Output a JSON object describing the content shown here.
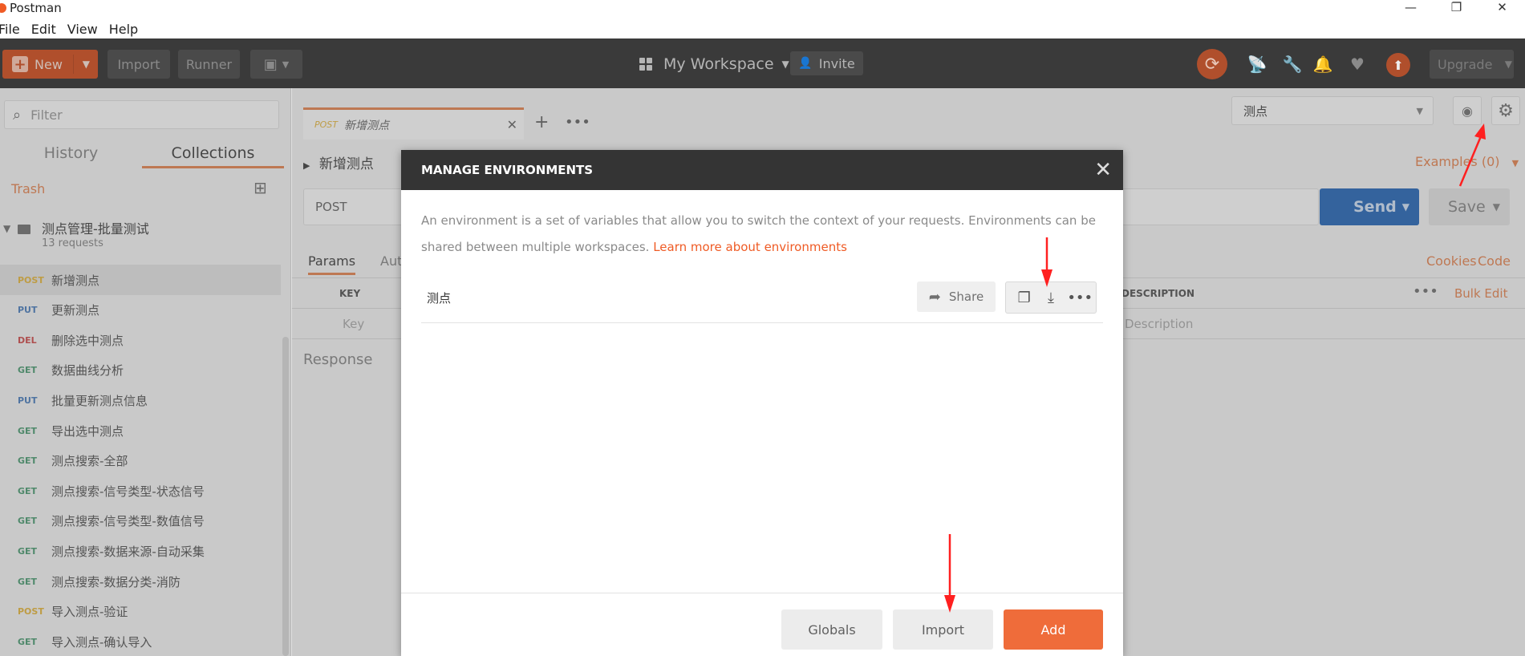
{
  "window": {
    "title": "Postman",
    "controls": [
      "—",
      "❐",
      "✕"
    ]
  },
  "menu": [
    "File",
    "Edit",
    "View",
    "Help"
  ],
  "header": {
    "new_label": "New",
    "import_label": "Import",
    "runner_label": "Runner",
    "workspace_label": "My Workspace",
    "invite_label": "Invite",
    "upgrade_label": "Upgrade"
  },
  "sidebar": {
    "filter_placeholder": "Filter",
    "tabs": [
      "History",
      "Collections"
    ],
    "trash_label": "Trash",
    "collection": {
      "name": "测点管理-批量测试",
      "count": "13 requests"
    },
    "requests": [
      {
        "method": "POST",
        "name": "新增测点"
      },
      {
        "method": "PUT",
        "name": "更新测点"
      },
      {
        "method": "DEL",
        "name": "删除选中测点"
      },
      {
        "method": "GET",
        "name": "数据曲线分析"
      },
      {
        "method": "PUT",
        "name": "批量更新测点信息"
      },
      {
        "method": "GET",
        "name": "导出选中测点"
      },
      {
        "method": "GET",
        "name": "测点搜索-全部"
      },
      {
        "method": "GET",
        "name": "测点搜索-信号类型-状态信号"
      },
      {
        "method": "GET",
        "name": "测点搜索-信号类型-数值信号"
      },
      {
        "method": "GET",
        "name": "测点搜索-数据来源-自动采集"
      },
      {
        "method": "GET",
        "name": "测点搜索-数据分类-消防"
      },
      {
        "method": "POST",
        "name": "导入测点-验证"
      },
      {
        "method": "GET",
        "name": "导入测点-确认导入"
      }
    ]
  },
  "main": {
    "tab": {
      "method": "POST",
      "name": "新增测点"
    },
    "env_selected": "测点",
    "request_title": "新增测点",
    "examples_label": "Examples (0)",
    "method": "POST",
    "send_label": "Send",
    "save_label": "Save",
    "params_tab": "Params",
    "auth_tab": "Aut",
    "cookies_label": "Cookies",
    "code_label": "Code",
    "key_header": "KEY",
    "key_placeholder": "Key",
    "desc_header": "DESCRIPTION",
    "desc_placeholder": "Description",
    "bulk_edit_label": "Bulk Edit",
    "response_label": "Response"
  },
  "modal": {
    "title": "MANAGE ENVIRONMENTS",
    "description": "An environment is a set of variables that allow you to switch the context of your requests. Environments can be shared between multiple workspaces.",
    "learn_more": "Learn more about environments",
    "environment_name": "测点",
    "share_label": "Share",
    "globals_label": "Globals",
    "import_label": "Import",
    "add_label": "Add"
  },
  "colors": {
    "accent": "#ef6c3a",
    "header_bg": "#3a3a3a",
    "modal_head": "#343434",
    "annotation": "#ff2020"
  }
}
